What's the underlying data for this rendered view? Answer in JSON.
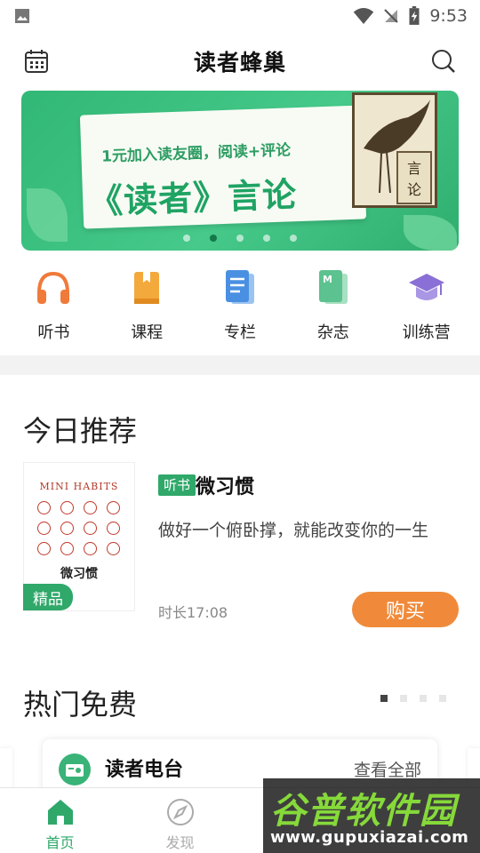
{
  "status_bar": {
    "time": "9:53"
  },
  "header": {
    "title": "读者蜂巢"
  },
  "banner": {
    "subtitle": "1元加入读友圈，阅读+评论",
    "headline": "《读者》言论",
    "art_label": [
      "言",
      "论"
    ],
    "slides": 5,
    "active_slide": 2
  },
  "categories": [
    {
      "label": "听书",
      "icon": "headphones-icon",
      "color": "#f07a3a"
    },
    {
      "label": "课程",
      "icon": "course-book-icon",
      "color": "#f3a93c"
    },
    {
      "label": "专栏",
      "icon": "column-doc-icon",
      "color": "#4a90e2"
    },
    {
      "label": "杂志",
      "icon": "magazine-icon",
      "color": "#5cc28f"
    },
    {
      "label": "训练营",
      "icon": "graduation-cap-icon",
      "color": "#8a6fd6"
    }
  ],
  "recommend": {
    "section_title": "今日推荐",
    "book_cover_title": "MINI HABITS",
    "book_cover_cn": "微习惯",
    "badge": "精品",
    "tag": "听书",
    "name": "微习惯",
    "description": "做好一个俯卧撑，就能改变你的一生",
    "duration": "时长17:08",
    "buy_label": "购买"
  },
  "hot_free": {
    "section_title": "热门免费",
    "pages": 4,
    "active_page": 1,
    "card": {
      "name": "读者电台",
      "more_label": "查看全部"
    }
  },
  "bottom_nav": [
    {
      "label": "首页",
      "icon": "home-icon",
      "active": true
    },
    {
      "label": "发现",
      "icon": "compass-icon",
      "active": false
    }
  ],
  "watermark": {
    "line1": "谷普软件园",
    "line2": "www.gupuxiazai.com"
  },
  "colors": {
    "brand_green": "#2fa86a",
    "buy_orange": "#f08a3a"
  }
}
